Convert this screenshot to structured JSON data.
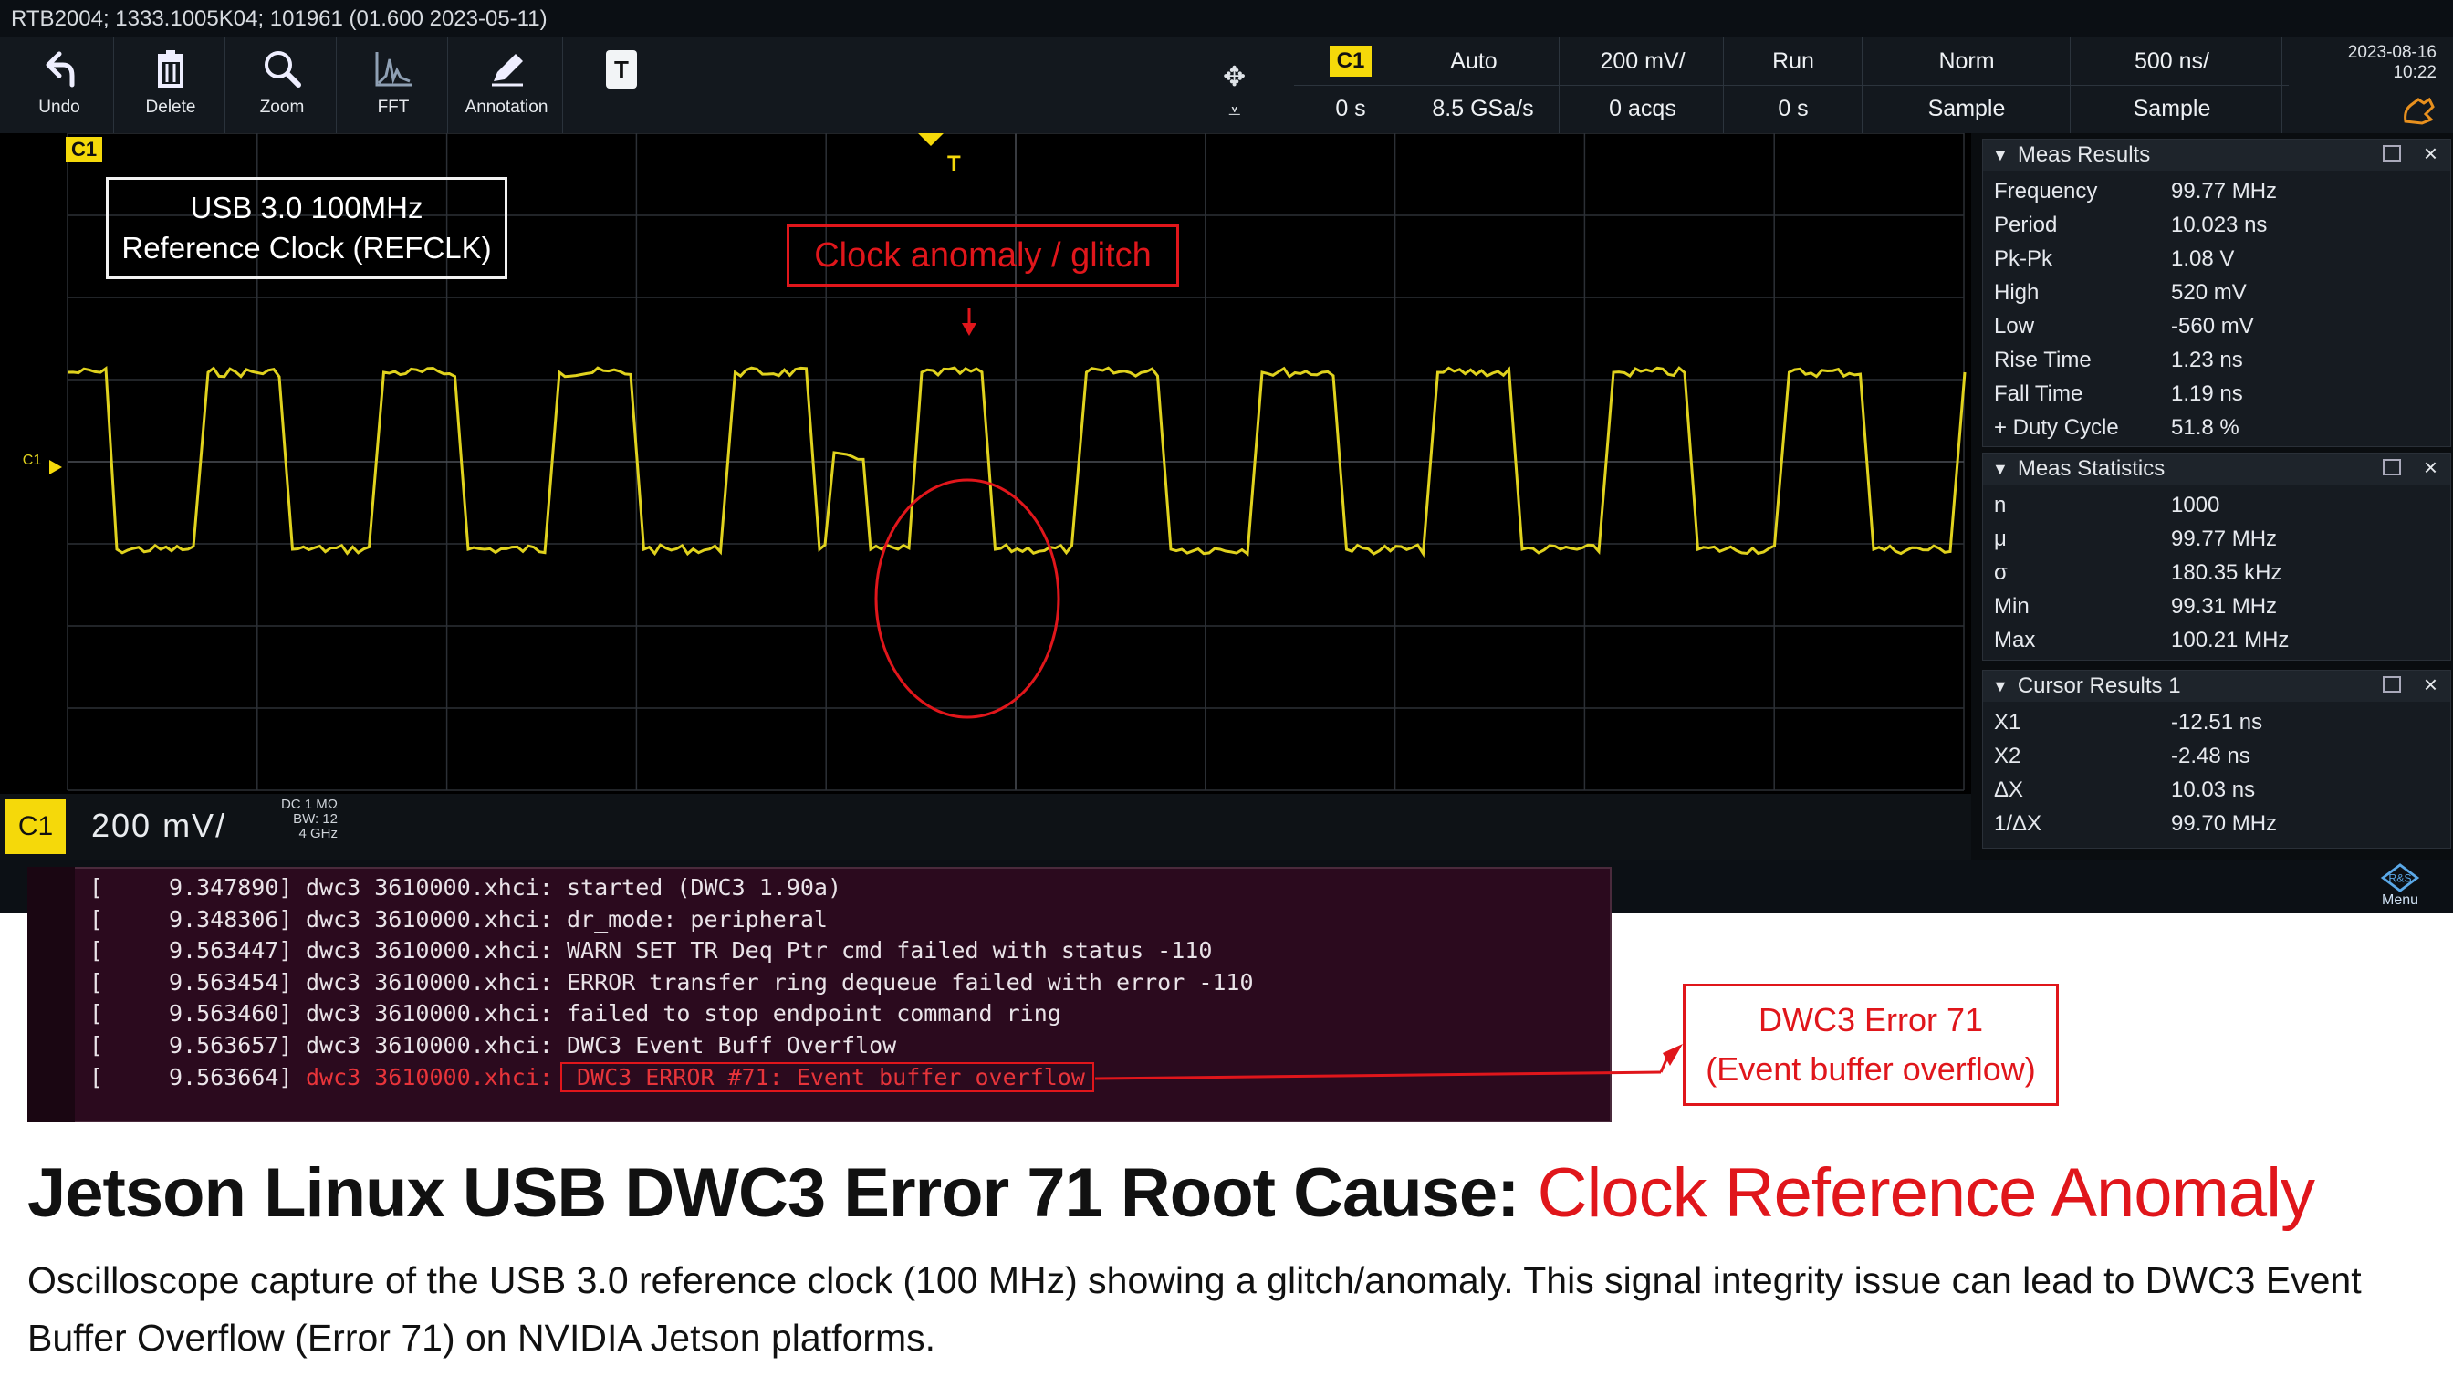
{
  "window": {
    "info": "RTB2004; 1333.1005K04; 101961 (01.600 2023-05-11)"
  },
  "toolbar": {
    "undo": "Undo",
    "delete": "Delete",
    "zoom": "Zoom",
    "fft": "FFT",
    "annotation": "Annotation",
    "text_tool": "T"
  },
  "header": {
    "channel": "C1",
    "position": "0 s",
    "trigger_mode": "Auto",
    "sample_rate": "8.5 GSa/s",
    "vertical_scale": "200 mV/",
    "acquisitions": "0 acqs",
    "run_state": "Run",
    "run_time": "0 s",
    "trigger_type": "Norm",
    "acq_mode_1": "Sample",
    "timebase": "500 ns/",
    "acq_mode_2": "Sample",
    "date": "2023-08-16",
    "time": "10:22"
  },
  "plot": {
    "channel_tag": "C1",
    "trigger_tag": "T",
    "signal_label_1": "USB 3.0 100MHz",
    "signal_label_2": "Reference Clock (REFCLK)",
    "anomaly_label": "Clock anomaly / glitch",
    "level_marker": "C1"
  },
  "meas_results": {
    "title": "Meas Results",
    "rows": [
      {
        "k": "Frequency",
        "v": "99.77 MHz"
      },
      {
        "k": "Period",
        "v": "10.023 ns"
      },
      {
        "k": "Pk-Pk",
        "v": "1.08 V"
      },
      {
        "k": "High",
        "v": "520 mV"
      },
      {
        "k": "Low",
        "v": "-560 mV"
      },
      {
        "k": "Rise Time",
        "v": "1.23 ns"
      },
      {
        "k": "Fall Time",
        "v": "1.19 ns"
      },
      {
        "k": "+ Duty Cycle",
        "v": "51.8 %"
      }
    ]
  },
  "meas_statistics": {
    "title": "Meas Statistics",
    "rows": [
      {
        "k": "n",
        "v": "1000"
      },
      {
        "k": "μ",
        "v": "99.77 MHz"
      },
      {
        "k": "σ",
        "v": "180.35 kHz"
      },
      {
        "k": "Min",
        "v": "99.31 MHz"
      },
      {
        "k": "Max",
        "v": "100.21 MHz"
      }
    ]
  },
  "cursor_results": {
    "title": "Cursor Results 1",
    "rows": [
      {
        "k": "X1",
        "v": "-12.51 ns"
      },
      {
        "k": "X2",
        "v": "-2.48 ns"
      },
      {
        "k": "ΔX",
        "v": "10.03 ns"
      },
      {
        "k": "1/ΔX",
        "v": "99.70 MHz"
      }
    ]
  },
  "channel_bar": {
    "channel": "C1",
    "scale": "200 mV/",
    "coupling": "DC",
    "impedance": "1 MΩ",
    "bw_label": "BW:",
    "bw_code": "12",
    "bandwidth": "4 GHz",
    "menu": "Menu"
  },
  "terminal": {
    "lines": [
      {
        "b": "[",
        "t": "9.347890]",
        "m": "dwc3 3610000.xhci: started (DWC3 1.90a)"
      },
      {
        "b": "[",
        "t": "9.348306]",
        "m": "dwc3 3610000.xhci: dr_mode: peripheral"
      },
      {
        "b": "[",
        "t": "9.563447]",
        "m": "dwc3 3610000.xhci: WARN SET TR Deq Ptr cmd failed with status -110"
      },
      {
        "b": "[",
        "t": "9.563454]",
        "m": "dwc3 3610000.xhci: ERROR transfer ring dequeue failed with error -110"
      },
      {
        "b": "[",
        "t": "9.563460]",
        "m": "dwc3 3610000.xhci: failed to stop endpoint command ring"
      },
      {
        "b": "[",
        "t": "9.563657]",
        "m": "dwc3 3610000.xhci: DWC3 Event Buff Overflow"
      },
      {
        "b": "[",
        "t": "9.563664]",
        "m_prefix": "dwc3 3610000.xhci:",
        "m_err": "DWC3 ERROR #71: Event buffer overflow"
      }
    ]
  },
  "callout": {
    "line1": "DWC3  Error 71",
    "line2": "(Event buffer overflow)"
  },
  "title": {
    "main": "Jetson Linux USB DWC3 Error 71 Root Cause: ",
    "highlight": "Clock Reference Anomaly"
  },
  "caption": "Oscilloscope capture of the USB 3.0 reference clock (100 MHz) showing a glitch/anomaly. This signal integrity issue can lead to DWC3 Event Buffer Overflow (Error 71) on NVIDIA Jetson platforms.",
  "colors": {
    "trace": "#e0d21e",
    "callout_red": "#e0161b",
    "c1_yellow": "#f5d90a",
    "trigger_yellow": "#f5d90a"
  }
}
